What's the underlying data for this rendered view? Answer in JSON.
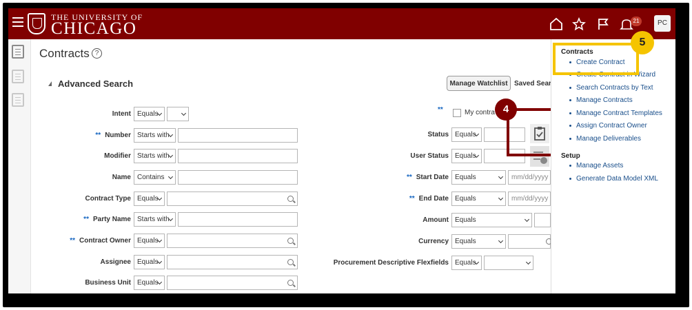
{
  "header": {
    "logo_line1": "THE UNIVERSITY OF",
    "logo_line2": "CHICAGO",
    "notification_count": "21",
    "avatar_initials": "PC",
    "brand_color": "#800000"
  },
  "page": {
    "title": "Contracts",
    "help_glyph": "?",
    "section_title": "Advanced Search",
    "manage_watchlist": "Manage Watchlist",
    "saved_search_label": "Saved Searc"
  },
  "form_left": [
    {
      "label": "Intent",
      "required": false,
      "operator": "Equals",
      "value": ""
    },
    {
      "label": "Number",
      "required": true,
      "operator": "Starts with",
      "value": ""
    },
    {
      "label": "Modifier",
      "required": false,
      "operator": "Starts with",
      "value": ""
    },
    {
      "label": "Name",
      "required": false,
      "operator": "Contains",
      "value": ""
    },
    {
      "label": "Contract Type",
      "required": false,
      "operator": "Equals",
      "value": ""
    },
    {
      "label": "Party Name",
      "required": true,
      "operator": "Starts with",
      "value": ""
    },
    {
      "label": "Contract Owner",
      "required": true,
      "operator": "Equals",
      "value": ""
    },
    {
      "label": "Assignee",
      "required": false,
      "operator": "Equals",
      "value": ""
    },
    {
      "label": "Business Unit",
      "required": false,
      "operator": "Equals",
      "value": ""
    }
  ],
  "form_right": {
    "required_marker": "**",
    "my_contracts_label": "My contra",
    "status": {
      "label": "Status",
      "operator": "Equals"
    },
    "user_status": {
      "label": "User Status",
      "operator": "Equals"
    },
    "start_date": {
      "label": "Start Date",
      "operator": "Equals",
      "placeholder": "mm/dd/yyyy"
    },
    "end_date": {
      "label": "End Date",
      "operator": "Equals",
      "placeholder": "mm/dd/yyyy"
    },
    "amount": {
      "label": "Amount",
      "operator": "Equals"
    },
    "currency": {
      "label": "Currency",
      "operator": "Equals"
    },
    "procurement": {
      "label": "Procurement Descriptive Flexfields",
      "operator": "Equals"
    }
  },
  "tasks_panel": {
    "section1_title": "Contracts",
    "links": [
      "Create Contract",
      "Create Contract in Wizard",
      "Search Contracts by Text",
      "Manage Contracts",
      "Manage Contract Templates",
      "Assign Contract Owner",
      "Manage Deliverables"
    ],
    "section2_title": "Setup",
    "setup_links": [
      "Manage Assets",
      "Generate Data Model XML"
    ]
  },
  "callouts": {
    "step4": "4",
    "step5": "5",
    "step4_color": "#800000",
    "step5_color": "#f5c400"
  }
}
